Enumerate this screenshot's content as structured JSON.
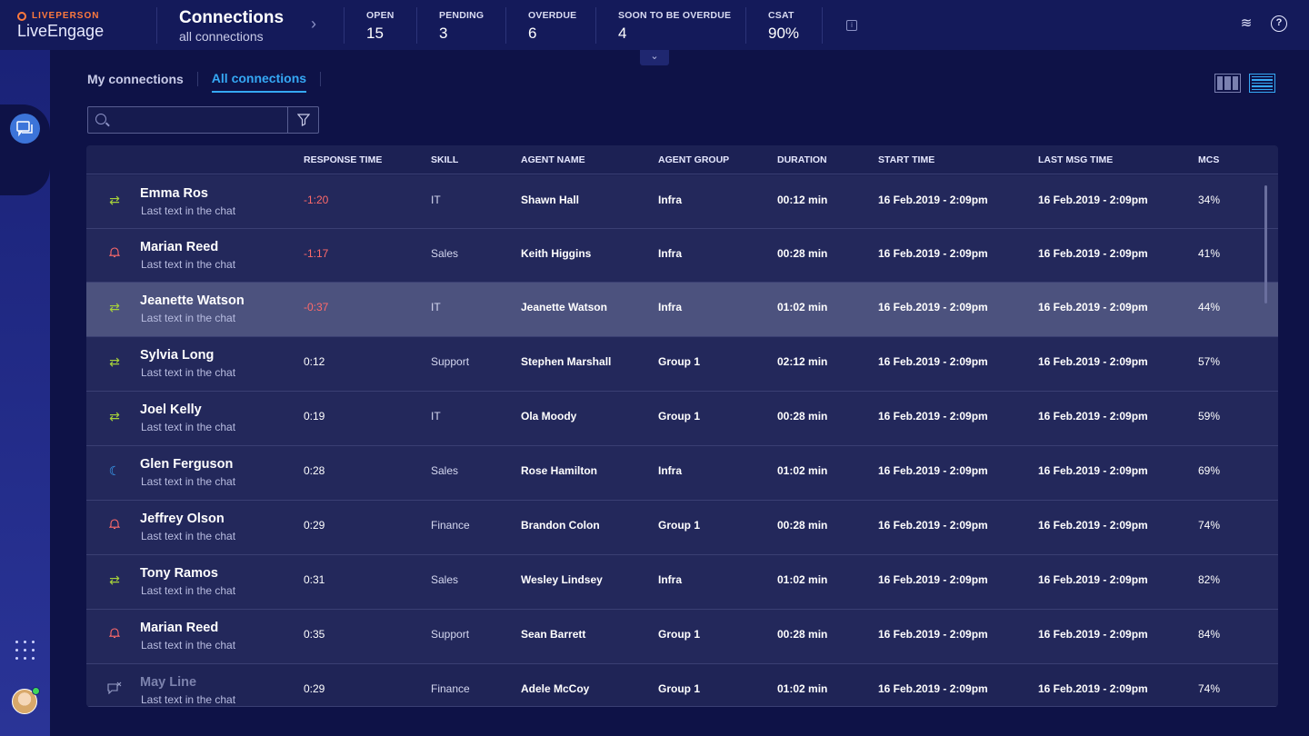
{
  "brand": {
    "vendor": "LIVEPERSON",
    "product": "LiveEngage"
  },
  "header": {
    "title": "Connections",
    "subtitle": "all connections",
    "stats": [
      {
        "label": "OPEN",
        "value": "15"
      },
      {
        "label": "PENDING",
        "value": "3"
      },
      {
        "label": "OVERDUE",
        "value": "6"
      },
      {
        "label": "SOON TO BE OVERDUE",
        "value": "4"
      },
      {
        "label": "CSAT",
        "value": "90%"
      }
    ]
  },
  "tabs": [
    {
      "label": "My connections",
      "active": false
    },
    {
      "label": "All connections",
      "active": true
    }
  ],
  "search": {
    "placeholder": ""
  },
  "table": {
    "columns": [
      "RESPONSE TIME",
      "SKILL",
      "AGENT NAME",
      "AGENT GROUP",
      "DURATION",
      "START TIME",
      "LAST MSG TIME",
      "MCS"
    ],
    "rows": [
      {
        "icon": "transfer-icon",
        "name": "Emma Ros",
        "sub": "Last text in the chat",
        "response": "-1:20",
        "skill": "IT",
        "agent": "Shawn Hall",
        "group": "Infra",
        "duration": "00:12 min",
        "start": "16 Feb.2019 - 2:09pm",
        "last": "16 Feb.2019 - 2:09pm",
        "mcs": "34%"
      },
      {
        "icon": "bell-icon",
        "name": "Marian Reed",
        "sub": "Last text in the chat",
        "response": "-1:17",
        "skill": "Sales",
        "agent": "Keith Higgins",
        "group": "Infra",
        "duration": "00:28 min",
        "start": "16 Feb.2019 - 2:09pm",
        "last": "16 Feb.2019 - 2:09pm",
        "mcs": "41%"
      },
      {
        "icon": "transfer-icon",
        "name": "Jeanette Watson",
        "sub": "Last text in the chat",
        "response": "-0:37",
        "skill": "IT",
        "agent": "Jeanette Watson",
        "group": "Infra",
        "duration": "01:02 min",
        "start": "16 Feb.2019 - 2:09pm",
        "last": "16 Feb.2019 - 2:09pm",
        "mcs": "44%"
      },
      {
        "icon": "transfer-icon",
        "name": "Sylvia Long",
        "sub": "Last text in the chat",
        "response": "0:12",
        "skill": "Support",
        "agent": "Stephen Marshall",
        "group": "Group 1",
        "duration": "02:12 min",
        "start": "16 Feb.2019 - 2:09pm",
        "last": "16 Feb.2019 - 2:09pm",
        "mcs": "57%"
      },
      {
        "icon": "transfer-icon",
        "name": "Joel Kelly",
        "sub": "Last text in the chat",
        "response": "0:19",
        "skill": "IT",
        "agent": "Ola Moody",
        "group": "Group 1",
        "duration": "00:28 min",
        "start": "16 Feb.2019 - 2:09pm",
        "last": "16 Feb.2019 - 2:09pm",
        "mcs": "59%"
      },
      {
        "icon": "moon-icon",
        "name": "Glen Ferguson",
        "sub": "Last text in the chat",
        "response": "0:28",
        "skill": "Sales",
        "agent": "Rose Hamilton",
        "group": "Infra",
        "duration": "01:02 min",
        "start": "16 Feb.2019 - 2:09pm",
        "last": "16 Feb.2019 - 2:09pm",
        "mcs": "69%"
      },
      {
        "icon": "bell-icon",
        "name": "Jeffrey Olson",
        "sub": "Last text in the chat",
        "response": "0:29",
        "skill": "Finance",
        "agent": "Brandon Colon",
        "group": "Group 1",
        "duration": "00:28 min",
        "start": "16 Feb.2019 - 2:09pm",
        "last": "16 Feb.2019 - 2:09pm",
        "mcs": "74%"
      },
      {
        "icon": "transfer-icon",
        "name": "Tony Ramos",
        "sub": "Last text in the chat",
        "response": "0:31",
        "skill": "Sales",
        "agent": "Wesley Lindsey",
        "group": "Infra",
        "duration": "01:02 min",
        "start": "16 Feb.2019 - 2:09pm",
        "last": "16 Feb.2019 - 2:09pm",
        "mcs": "82%"
      },
      {
        "icon": "bell-icon",
        "name": "Marian Reed",
        "sub": "Last text in the chat",
        "response": "0:35",
        "skill": "Support",
        "agent": "Sean Barrett",
        "group": "Group 1",
        "duration": "00:28 min",
        "start": "16 Feb.2019 - 2:09pm",
        "last": "16 Feb.2019 - 2:09pm",
        "mcs": "84%"
      },
      {
        "icon": "chat-off-icon",
        "name": "May Line",
        "sub": "Last text in the chat",
        "response": "0:29",
        "skill": "Finance",
        "agent": "Adele McCoy",
        "group": "Group 1",
        "duration": "01:02 min",
        "start": "16 Feb.2019 - 2:09pm",
        "last": "16 Feb.2019 - 2:09pm",
        "mcs": "74%"
      }
    ]
  },
  "colors": {
    "accent": "#35a8f5",
    "negative": "#ff6a6a",
    "transfer": "#a6d13a",
    "background": "#0e1247"
  }
}
